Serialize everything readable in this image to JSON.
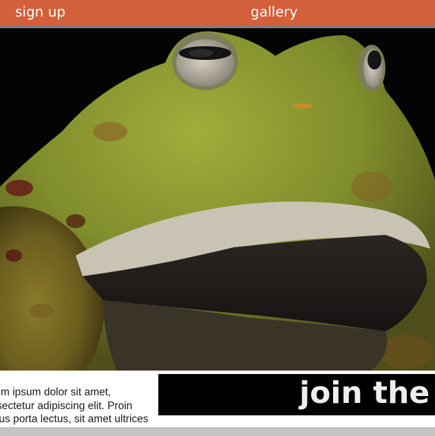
{
  "nav": {
    "signup_label": "sign up",
    "gallery_label": "gallery"
  },
  "hero": {
    "image_subject": "frog-photo"
  },
  "intro": {
    "text": "Lorem ipsum dolor sit amet, consectetur adipiscing elit. Proin finibus porta lectus, sit amet ultrices turpis blandit non. Nam porta"
  },
  "cta": {
    "text": "join the c"
  },
  "colors": {
    "nav_bg": "#d35f3b",
    "nav_border": "#7e7e7e",
    "banner_bg": "#000000",
    "footer": "#c3c3c3"
  }
}
